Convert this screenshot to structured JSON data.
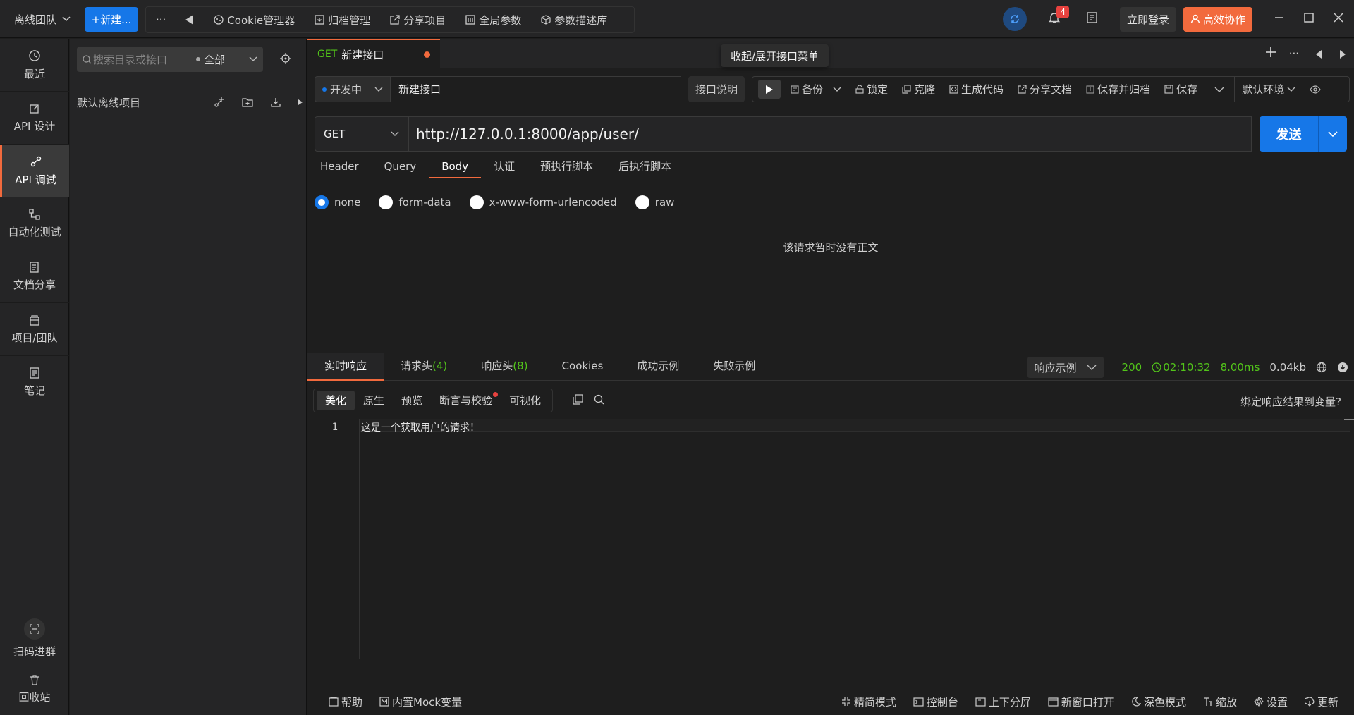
{
  "topbar": {
    "team": "离线团队",
    "new_label": "+新建...",
    "more": "···",
    "tools": [
      "Cookie管理器",
      "归档管理",
      "分享项目",
      "全局参数",
      "参数描述库"
    ],
    "badge_count": "4",
    "login": "立即登录",
    "collab": "高效协作"
  },
  "nav": {
    "items": [
      {
        "label": "最近",
        "icon": "clock-icon"
      },
      {
        "label": "API 设计",
        "icon": "edit-icon"
      },
      {
        "label": "API 调试",
        "icon": "debug-icon"
      },
      {
        "label": "自动化测试",
        "icon": "flow-icon"
      },
      {
        "label": "文档分享",
        "icon": "doc-icon"
      },
      {
        "label": "项目/团队",
        "icon": "project-icon"
      },
      {
        "label": "笔记",
        "icon": "note-icon"
      }
    ],
    "qr": "扫码进群",
    "trash": "回收站"
  },
  "tree": {
    "search_placeholder": "搜索目录或接口",
    "filter": "全部",
    "project": "默认离线项目"
  },
  "tab": {
    "method": "GET",
    "name": "新建接口"
  },
  "tooltip": "收起/展开接口菜单",
  "request": {
    "status": "开发中",
    "name": "新建接口",
    "desc_btn": "接口说明",
    "actions": [
      "备份",
      "锁定",
      "克隆",
      "生成代码",
      "分享文档",
      "保存并归档",
      "保存"
    ],
    "env": "默认环境",
    "method": "GET",
    "url": "http://127.0.0.1:8000/app/user/",
    "send": "发送",
    "tabs": [
      "Header",
      "Query",
      "Body",
      "认证",
      "预执行脚本",
      "后执行脚本"
    ],
    "body_types": [
      "none",
      "form-data",
      "x-www-form-urlencoded",
      "raw"
    ],
    "empty_body": "该请求暂时没有正文"
  },
  "response": {
    "tabs": [
      "实时响应",
      "请求头",
      "响应头",
      "Cookies",
      "成功示例",
      "失败示例"
    ],
    "req_header_count": "(4)",
    "res_header_count": "(8)",
    "example_select": "响应示例",
    "status_code": "200",
    "time": "02:10:32",
    "duration": "8.00ms",
    "size": "0.04kb",
    "subtabs": [
      "美化",
      "原生",
      "预览",
      "断言与校验",
      "可视化"
    ],
    "bind_var": "绑定响应结果到变量?",
    "line_number": "1",
    "body_text": "这是一个获取用户的请求！"
  },
  "bottombar": {
    "left": [
      "帮助",
      "内置Mock变量"
    ],
    "right": [
      "精简模式",
      "控制台",
      "上下分屏",
      "新窗口打开",
      "深色模式",
      "缩放",
      "设置",
      "更新"
    ]
  },
  "colors": {
    "accent": "#f26a3d",
    "primary": "#1677e8",
    "success": "#52c41a"
  }
}
